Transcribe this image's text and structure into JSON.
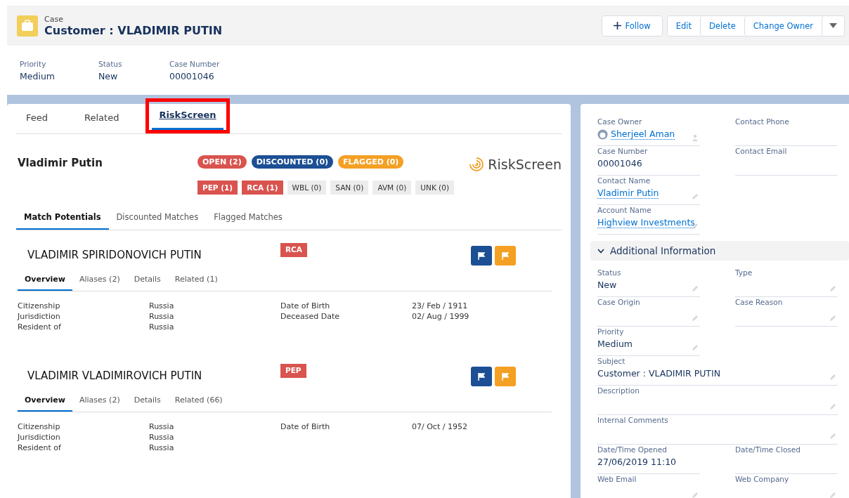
{
  "header": {
    "object_type": "Case",
    "title": "Customer : VLADIMIR PUTIN",
    "buttons": [
      {
        "label": "Follow",
        "kind": "follow"
      },
      {
        "label": "Edit",
        "kind": "plain"
      },
      {
        "label": "Delete",
        "kind": "plain"
      },
      {
        "label": "Change Owner",
        "kind": "plain"
      },
      {
        "kind": "menu"
      }
    ]
  },
  "highlights": [
    {
      "label": "Priority",
      "value": "Medium"
    },
    {
      "label": "Status",
      "value": "New"
    },
    {
      "label": "Case Number",
      "value": "00001046"
    }
  ],
  "tabs": [
    {
      "label": "Feed",
      "selected": false,
      "annotated": false
    },
    {
      "label": "Related",
      "selected": false,
      "annotated": false
    },
    {
      "label": "RiskScreen",
      "selected": true,
      "annotated": true
    }
  ],
  "riskscreen": {
    "subject": "Vladimir Putin",
    "logo": "RiskScreen",
    "counts": [
      {
        "label": "OPEN (2)",
        "color": "#d9534f"
      },
      {
        "label": "DISCOUNTED (0)",
        "color": "#1c4f94"
      },
      {
        "label": "FLAGGED (0)",
        "color": "#f4a024"
      }
    ],
    "categories": [
      {
        "label": "PEP (1)",
        "active": true
      },
      {
        "label": "RCA (1)",
        "active": true
      },
      {
        "label": "WBL (0)",
        "active": false
      },
      {
        "label": "SAN (0)",
        "active": false
      },
      {
        "label": "AVM (0)",
        "active": false
      },
      {
        "label": "UNK (0)",
        "active": false
      }
    ],
    "match_tabs": [
      {
        "label": "Match Potentials",
        "selected": true
      },
      {
        "label": "Discounted Matches",
        "selected": false
      },
      {
        "label": "Flagged Matches",
        "selected": false
      }
    ],
    "matches": [
      {
        "name": "VLADIMIR SPIRIDONOVICH PUTIN",
        "tag": "RCA",
        "tabs": [
          {
            "label": "Overview",
            "selected": true
          },
          {
            "label": "Aliases (2)",
            "selected": false
          },
          {
            "label": "Details",
            "selected": false
          },
          {
            "label": "Related (1)",
            "selected": false
          }
        ],
        "left": [
          {
            "label": "Citizenship",
            "value": "Russia"
          },
          {
            "label": "Jurisdiction",
            "value": "Russia"
          },
          {
            "label": "Resident of",
            "value": "Russia"
          }
        ],
        "right": [
          {
            "label": "Date of Birth",
            "value": "23/ Feb / 1911"
          },
          {
            "label": "Deceased Date",
            "value": "02/ Aug / 1999"
          }
        ]
      },
      {
        "name": "VLADIMIR VLADIMIROVICH PUTIN",
        "tag": "PEP",
        "tabs": [
          {
            "label": "Overview",
            "selected": true
          },
          {
            "label": "Aliases (2)",
            "selected": false
          },
          {
            "label": "Details",
            "selected": false
          },
          {
            "label": "Related (66)",
            "selected": false
          }
        ],
        "left": [
          {
            "label": "Citizenship",
            "value": "Russia"
          },
          {
            "label": "Jurisdiction",
            "value": "Russia"
          },
          {
            "label": "Resident of",
            "value": "Russia"
          }
        ],
        "right": [
          {
            "label": "Date of Birth",
            "value": "07/ Oct / 1952"
          }
        ]
      }
    ]
  },
  "details": {
    "top_rows": [
      [
        {
          "label": "Case Owner",
          "value": "Sherjeel Aman",
          "link": true,
          "kind": "owner"
        },
        {
          "label": "Contact Phone",
          "kind": "readonly"
        }
      ],
      [
        {
          "label": "Case Number",
          "value": "00001046",
          "link": false,
          "kind": "readonly"
        },
        {
          "label": "Contact Email",
          "kind": "readonly"
        }
      ],
      [
        {
          "label": "Contact Name",
          "value": "Vladimir Putin",
          "link": true,
          "kind": "edit"
        }
      ],
      [
        {
          "label": "Account Name",
          "value": "Highview Investments",
          "link": true,
          "kind": "edit"
        }
      ]
    ],
    "section": {
      "title": "Additional Information",
      "expanded": true
    },
    "rows": [
      [
        {
          "label": "Status",
          "value": "New",
          "link": false,
          "kind": "edit"
        },
        {
          "label": "Type",
          "kind": "edit"
        }
      ],
      [
        {
          "label": "Case Origin",
          "kind": "edit"
        },
        {
          "label": "Case Reason",
          "kind": "edit"
        }
      ],
      [
        {
          "label": "Priority",
          "value": "Medium",
          "link": false,
          "kind": "edit"
        }
      ],
      [
        {
          "label": "Subject",
          "value": "Customer : VLADIMIR PUTIN",
          "link": false,
          "kind": "edit",
          "wide": true
        }
      ],
      [
        {
          "label": "Description",
          "kind": "edit",
          "wide": true
        }
      ],
      [
        {
          "label": "Internal Comments",
          "kind": "edit",
          "wide": true
        }
      ],
      [
        {
          "label": "Date/Time Opened",
          "value": "27/06/2019 11:10",
          "link": false,
          "kind": "readonly"
        },
        {
          "label": "Date/Time Closed",
          "kind": "readonly"
        }
      ],
      [
        {
          "label": "Web Email",
          "kind": "edit"
        },
        {
          "label": "Web Company",
          "kind": "edit"
        }
      ]
    ]
  }
}
